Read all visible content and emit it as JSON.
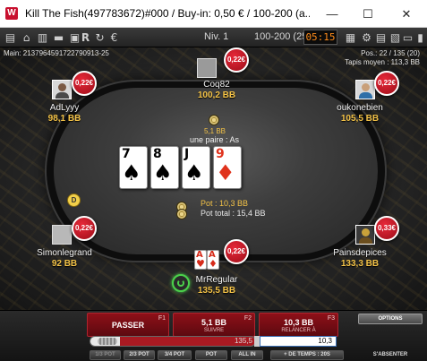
{
  "window": {
    "title": "Kill The Fish(497783672)#000 / Buy-in: 0,50 € / 100-200 (a...",
    "minimize": "—",
    "maximize": "☐",
    "close": "✕"
  },
  "toolbar": {
    "level": "Niv. 1",
    "stakes": "100-200 (25)",
    "clock": "05:15"
  },
  "table": {
    "hand_id": "Main: 2137964591722790913-25",
    "position": "Pos.: 22 / 135 (20)",
    "avg_stack": "Tapis moyen : 113,3 BB"
  },
  "players": {
    "coq82": {
      "name": "Coq82",
      "stack": "100,2 BB",
      "bounty": "0,22€"
    },
    "adlyyy": {
      "name": "AdLyyy",
      "stack": "98,1 BB",
      "bounty": "0,22€"
    },
    "oukonebien": {
      "name": "oukonebien",
      "stack": "105,5 BB",
      "bounty": "0,22€"
    },
    "simonlegrand": {
      "name": "Simonlegrand",
      "stack": "92 BB",
      "bounty": "0,22€"
    },
    "painsdepices": {
      "name": "Painsdepices",
      "stack": "133,3 BB",
      "bounty": "0,33€"
    },
    "hero": {
      "name": "MrRegular",
      "stack": "135,5 BB",
      "bounty": "0,22€",
      "card1_rank": "A",
      "card1_suit": "♥",
      "card2_rank": "A",
      "card2_suit": "♦"
    }
  },
  "dealer_label": "D",
  "board": {
    "bet": "5,1 BB",
    "hand_desc": "une paire : As",
    "cards": [
      {
        "rank": "7",
        "suit": "♠",
        "color": "black"
      },
      {
        "rank": "8",
        "suit": "♠",
        "color": "black"
      },
      {
        "rank": "J",
        "suit": "♠",
        "color": "black"
      },
      {
        "rank": "9",
        "suit": "♦",
        "color": "red"
      }
    ],
    "pot": "Pot : 10,3 BB",
    "pot_total": "Pot total : 15,4 BB"
  },
  "actions": {
    "fold": {
      "label": "PASSER",
      "key": "F1"
    },
    "call": {
      "label": "5,1 BB",
      "sub": "SUIVRE",
      "key": "F2"
    },
    "raise": {
      "label": "10,3 BB",
      "sub": "RELANCER À",
      "key": "F3"
    },
    "options": "OPTIONS",
    "slider_max": "135,5",
    "amount": "10,3",
    "presets": [
      "1/3 POT",
      "2/3 POT",
      "3/4 POT",
      "POT",
      "ALL IN"
    ],
    "timebank": "+ DE TEMPS : 20S",
    "sitout": "S'ABSENTER"
  }
}
